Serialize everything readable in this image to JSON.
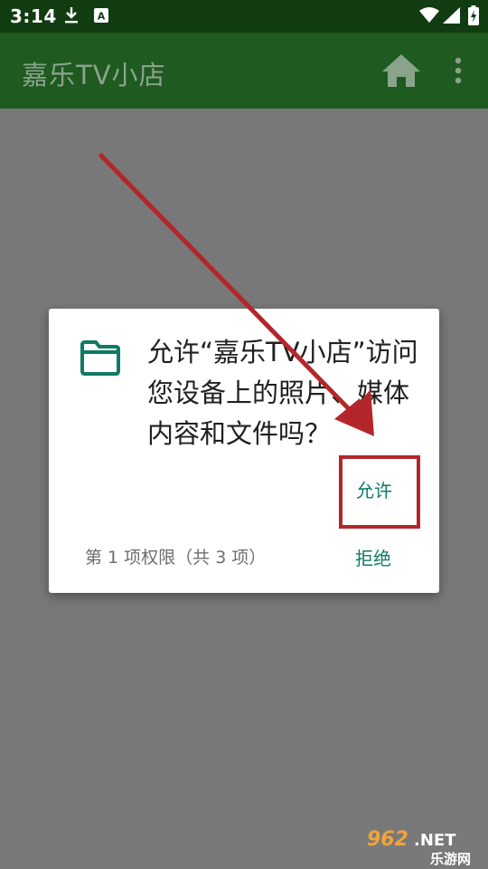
{
  "status_bar": {
    "time": "3:14",
    "icons": [
      "download-icon",
      "a-notification-icon",
      "wifi-icon",
      "signal-icon",
      "battery-charging-icon"
    ]
  },
  "app_bar": {
    "title": "嘉乐TV小店",
    "actions": [
      "home-icon",
      "more-vert-icon"
    ]
  },
  "dialog": {
    "icon": "folder-icon",
    "message": "允许“嘉乐TV小店”访问您设备上的照片、媒体内容和文件吗？",
    "allow_label": "允许",
    "deny_label": "拒绝",
    "counter": "第 1 项权限（共 3 项）"
  },
  "annotation": {
    "arrow_color": "#b3262a",
    "highlight_color": "#b3262a",
    "highlight_target": "允许"
  },
  "watermark": {
    "text_top": "962.NET",
    "text_bottom": "乐游网"
  },
  "colors": {
    "status_bar": "#113c12",
    "app_bar": "#1f5a21",
    "scrim": "#787878",
    "accent": "#0f7a67"
  }
}
